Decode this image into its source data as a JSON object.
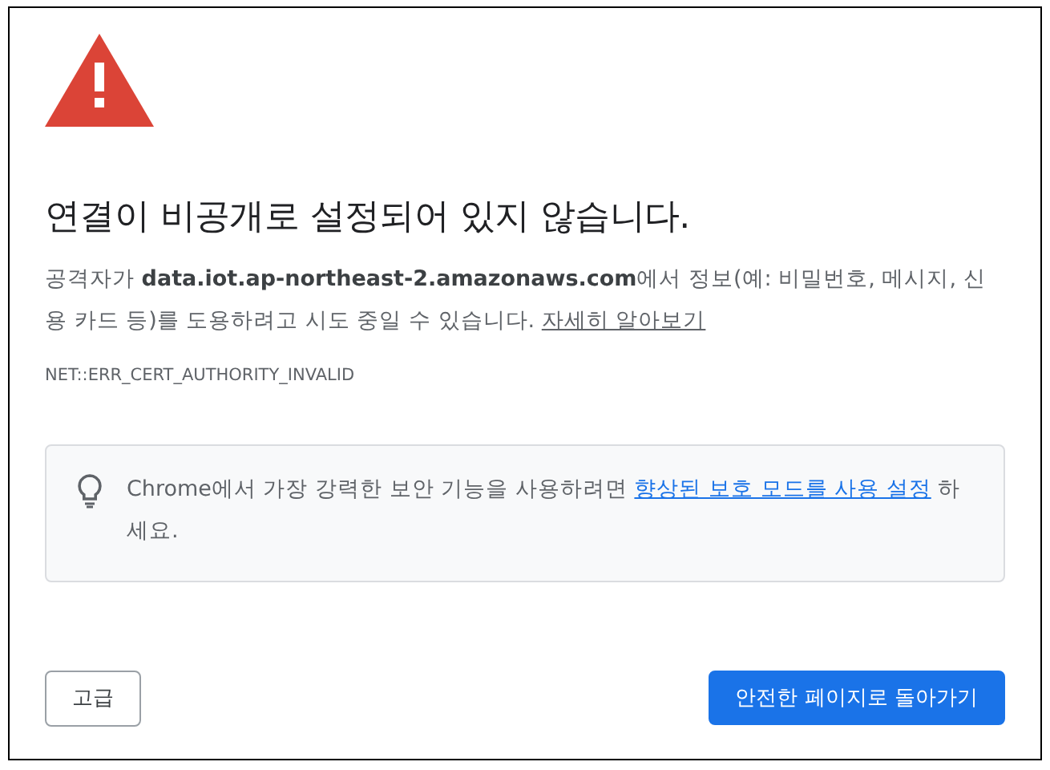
{
  "heading": "연결이 비공개로 설정되어 있지 않습니다.",
  "description": "공격자가 **data.iot.ap-northeast-2.amazonaws.com**에서 정보(예: 비밀번호, 메시지, 신용 카드 등)를 도용하려고 시도 중일 수 있습니다.",
  "learn_more_link": "자세히 알아보기",
  "error_code": "NET::ERR_CERT_AUTHORITY_INVALID",
  "tip": {
    "text_before": "Chrome에서 가장 강력한 보안 기능을 사용하려면",
    "link": "향상된 보호 모드를 사용 설정",
    "text_after": "하세요."
  },
  "buttons": [
    {
      "label": "고급",
      "kind": "secondary"
    },
    {
      "label": "안전한 페이지로 돌아가기",
      "kind": "primary"
    }
  ]
}
